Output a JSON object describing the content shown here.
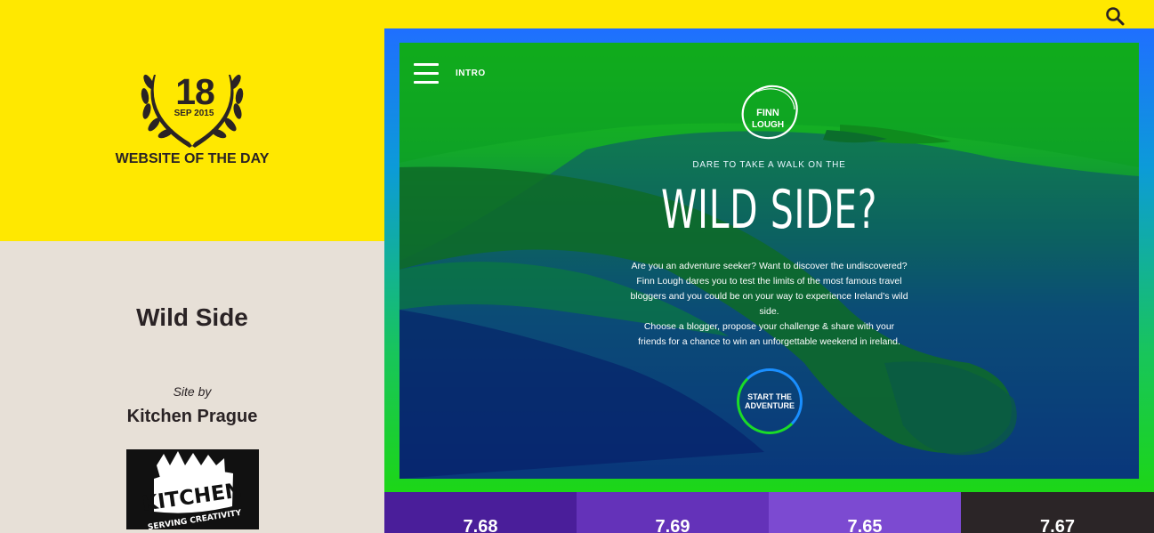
{
  "search": {
    "icon": "search-icon"
  },
  "award": {
    "day": "18",
    "month": "SEP 2015",
    "label": "WEBSITE OF THE DAY"
  },
  "site": {
    "title": "Wild Side",
    "by": "Site by",
    "agency": "Kitchen Prague",
    "agency_logo_text": "KITCHEN SERVING CREATIVITY"
  },
  "screenshot": {
    "nav_label": "INTRO",
    "brand": "FINN LOUGH",
    "tagline": "DARE TO TAKE A WALK ON THE",
    "headline": "WILD SIDE?",
    "body": [
      "Are you an adventure seeker? Want to discover the undiscovered?",
      "Finn Lough dares you to test the limits of the most famous travel",
      "bloggers and you could be on your way to experience Ireland’s wild",
      "side.",
      "Choose a blogger, propose your challenge & share with your",
      "friends for a chance to win an unforgettable weekend in ireland."
    ],
    "cta": "START THE ADVENTURE",
    "colors": {
      "frame_top": "#1f6fff",
      "frame_bottom": "#1cd617",
      "overlay_green": "#19c20e",
      "overlay_blue": "#061e84"
    }
  },
  "scores": [
    {
      "value": "7.68",
      "color": "#4a1e9a"
    },
    {
      "value": "7.69",
      "color": "#6432b9"
    },
    {
      "value": "7.65",
      "color": "#7c4ad1"
    },
    {
      "value": "7.67",
      "color": "#2b2527"
    }
  ],
  "colors": {
    "yellow": "#ffe800",
    "beige": "#e7e0d7",
    "dark": "#2a2325"
  }
}
